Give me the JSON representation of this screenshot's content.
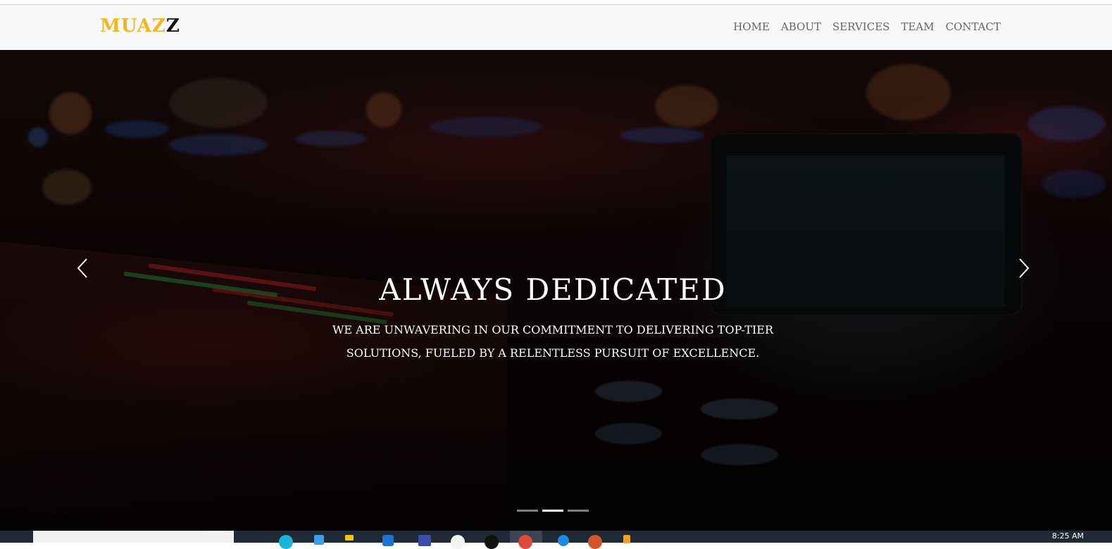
{
  "brand": {
    "accent_text": "MUAZ",
    "dark_text": "Z",
    "accent_color": "#f4b619"
  },
  "nav": {
    "items": [
      {
        "label": "HOME"
      },
      {
        "label": "ABOUT"
      },
      {
        "label": "SERVICES"
      },
      {
        "label": "TEAM"
      },
      {
        "label": "CONTACT"
      }
    ]
  },
  "hero": {
    "title": "ALWAYS DEDICATED",
    "subtitle": "WE ARE UNWAVERING IN OUR COMMITMENT TO DELIVERING TOP-TIER SOLUTIONS, FUELED BY A RELENTLESS PURSUIT OF EXCELLENCE.",
    "prev_icon": "chevron-left-icon",
    "next_icon": "chevron-right-icon",
    "slide_count": 3,
    "active_slide": 2
  },
  "taskbar": {
    "clock": "8:25 AM"
  }
}
